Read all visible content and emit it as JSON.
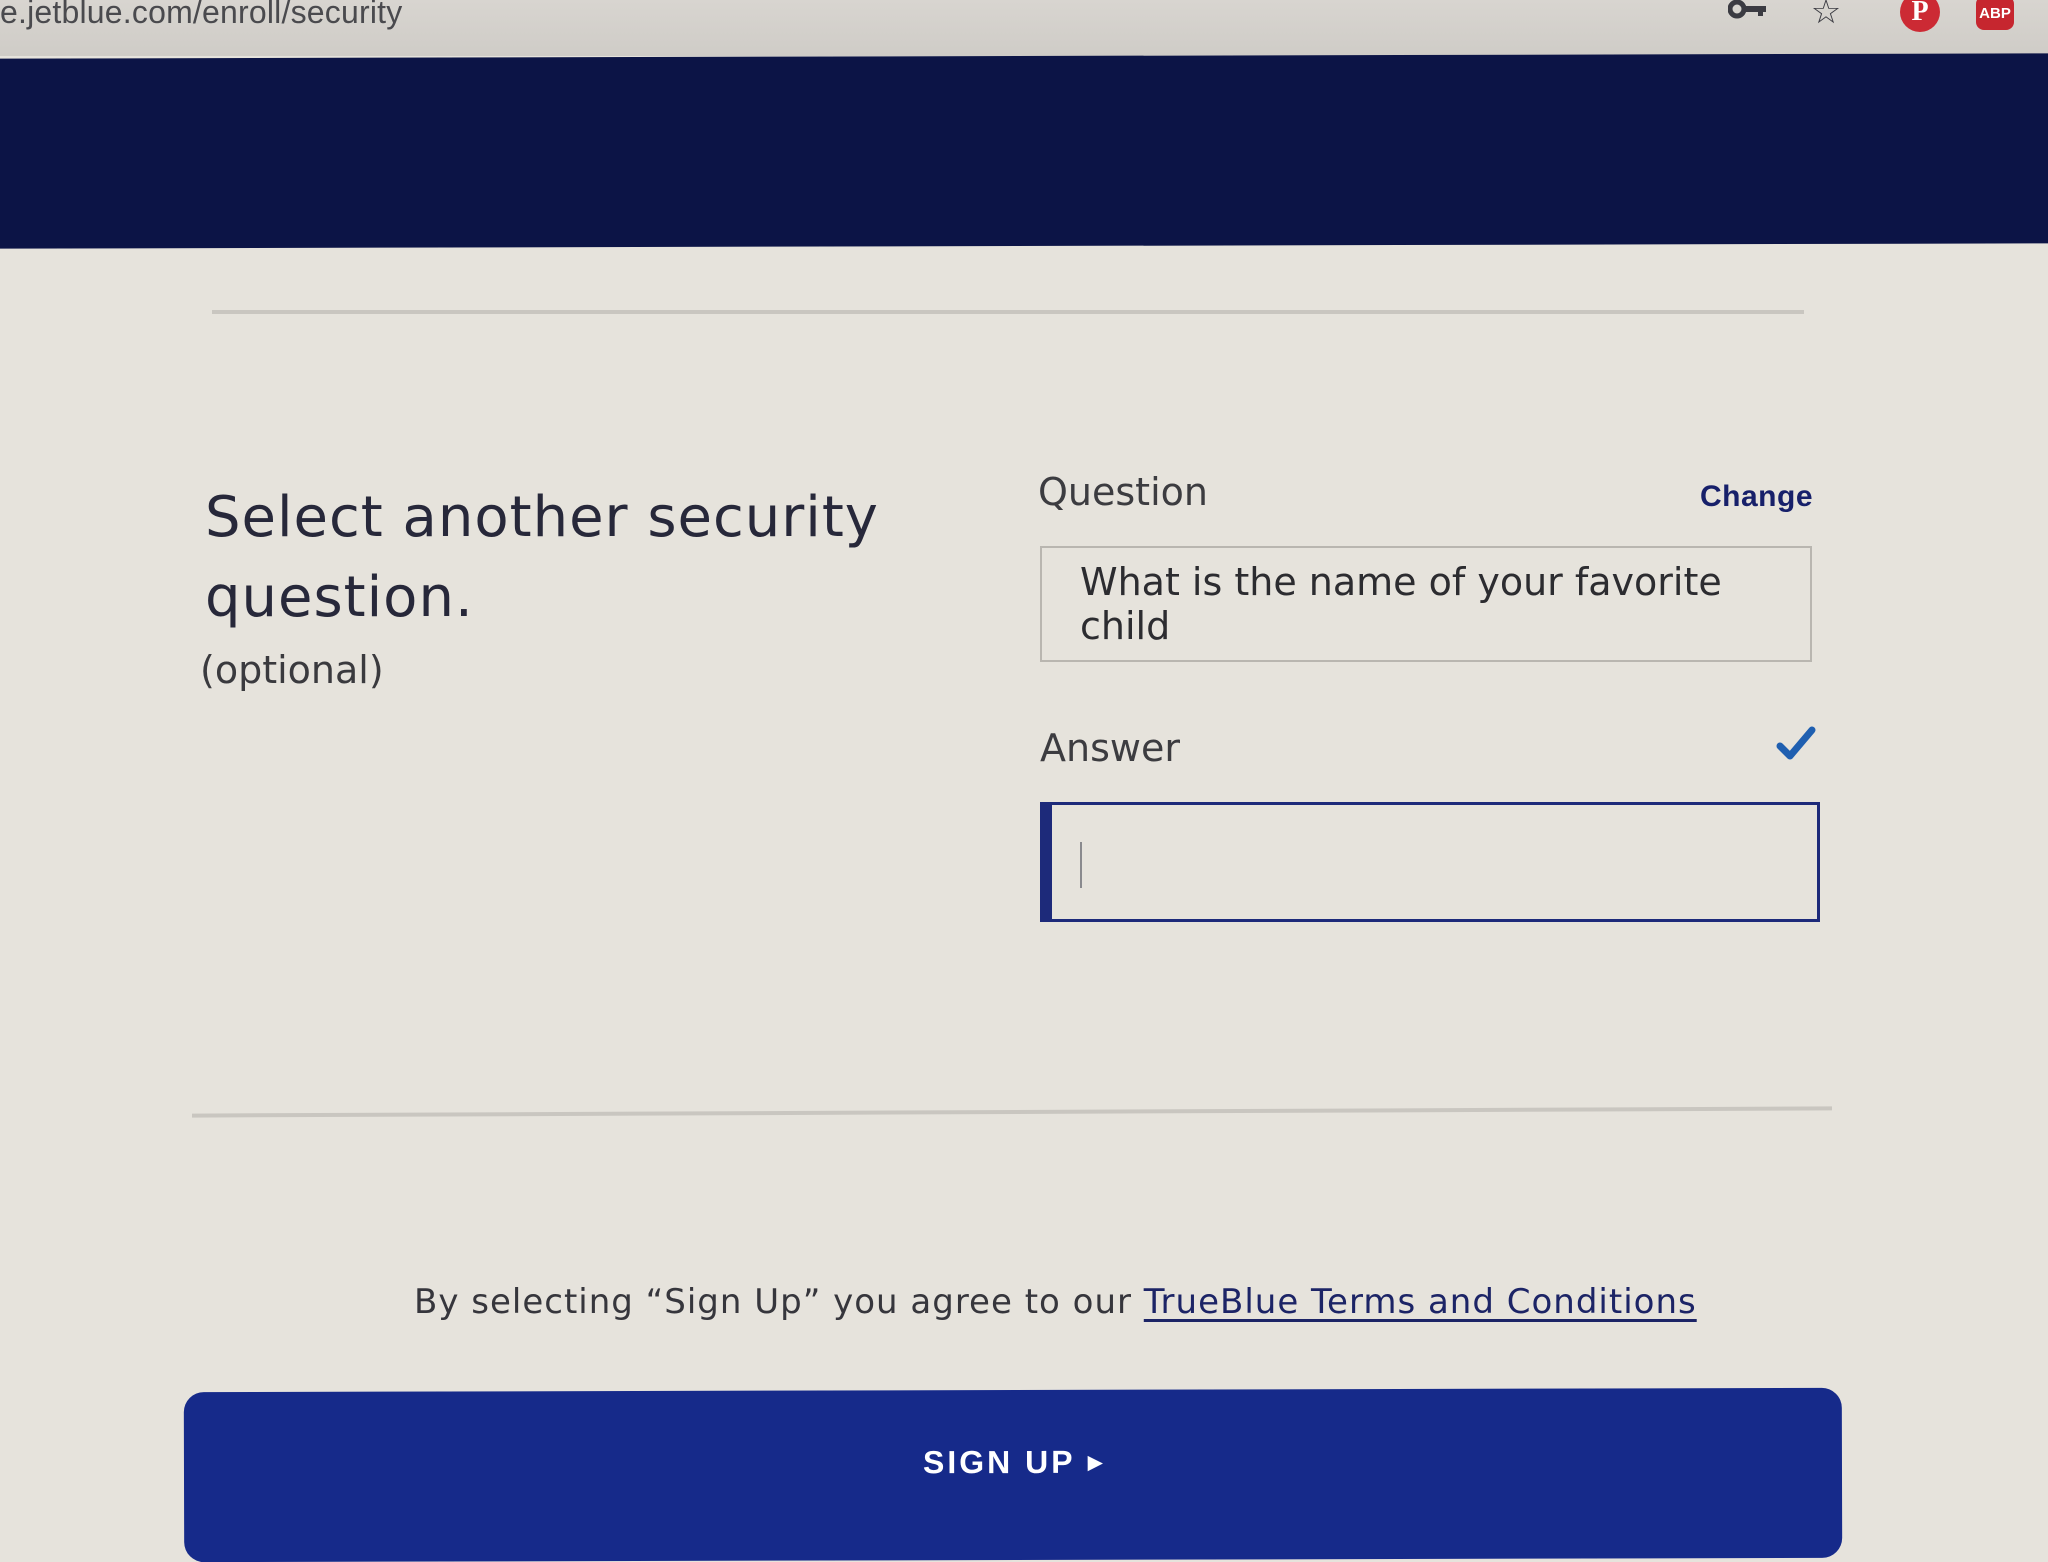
{
  "browser": {
    "url": "e.jetblue.com/enroll/security",
    "icons": {
      "key": "key-icon",
      "star": "☆",
      "pinterest": "P",
      "abp": "ABP"
    }
  },
  "section": {
    "title": "Select another security question.",
    "subtitle": "(optional)"
  },
  "question_field": {
    "label": "Question",
    "change_label": "Change",
    "value": "What is the name of your favorite child"
  },
  "answer_field": {
    "label": "Answer",
    "value": "",
    "placeholder": "",
    "status_icon": "checkmark-icon"
  },
  "terms": {
    "prefix": "By selecting “Sign Up” you agree to our ",
    "link_label": "TrueBlue Terms and Conditions"
  },
  "signup_button": {
    "label": "SIGN UP",
    "arrow": "▶"
  },
  "colors": {
    "header": "#0c1446",
    "accent": "#162a8a",
    "link": "#17206a",
    "check": "#1f5fb0"
  }
}
